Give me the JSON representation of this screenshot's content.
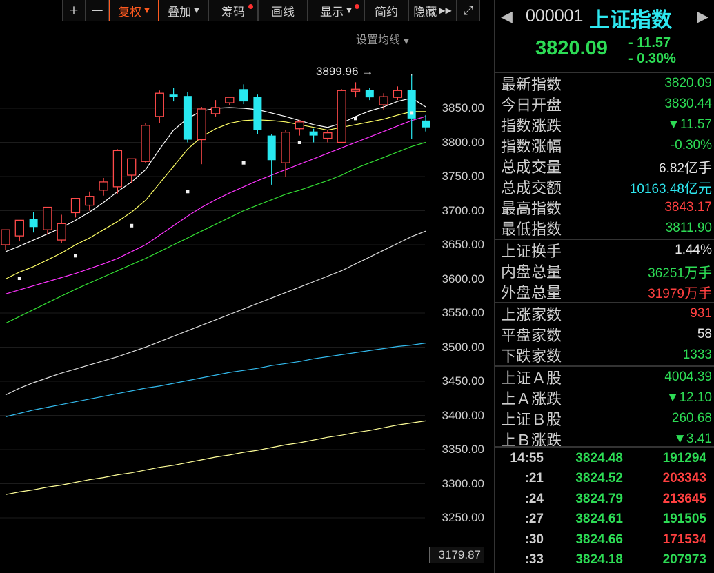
{
  "toolbar": {
    "buttons": [
      "+",
      "—",
      "复权",
      "叠加",
      "筹码",
      "画线",
      "显示",
      "简约",
      "隐藏"
    ],
    "more_icon": "double-chevron-right-icon",
    "expand_icon": "fullscreen-icon",
    "active_color": "#ff5a1f"
  },
  "ma_setting": "设置均线",
  "price_axis": [
    "3850.00",
    "3800.00",
    "3750.00",
    "3700.00",
    "3650.00",
    "3600.00",
    "3550.00",
    "3500.00",
    "3450.00",
    "3400.00",
    "3350.00",
    "3300.00",
    "3250.00"
  ],
  "low_label": "3179.87",
  "high_annotation": "3899.96",
  "chart_data": {
    "type": "candlestick",
    "ylim": [
      3179.87,
      3950
    ],
    "up_color": "#ff4a4a",
    "down_color": "#28e8f0",
    "candles": [
      [
        3650,
        3672,
        3642,
        3665
      ],
      [
        3663,
        3686,
        3655,
        3678
      ],
      [
        3688,
        3676,
        3668,
        3698
      ],
      [
        3672,
        3705,
        3665,
        3695
      ],
      [
        3657,
        3681,
        3653,
        3694
      ],
      [
        3697,
        3718,
        3690,
        3712
      ],
      [
        3708,
        3721,
        3700,
        3728
      ],
      [
        3730,
        3742,
        3722,
        3748
      ],
      [
        3735,
        3788,
        3725,
        3790
      ],
      [
        3752,
        3776,
        3740,
        3768
      ],
      [
        3772,
        3825,
        3770,
        3828
      ],
      [
        3838,
        3872,
        3828,
        3876
      ],
      [
        3870,
        3867,
        3860,
        3880
      ],
      [
        3868,
        3804,
        3800,
        3874
      ],
      [
        3804,
        3849,
        3768,
        3852
      ],
      [
        3842,
        3851,
        3838,
        3862
      ],
      [
        3858,
        3866,
        3855,
        3866
      ],
      [
        3878,
        3860,
        3856,
        3885
      ],
      [
        3867,
        3818,
        3812,
        3870
      ],
      [
        3810,
        3774,
        3738,
        3812
      ],
      [
        3770,
        3815,
        3750,
        3818
      ],
      [
        3820,
        3830,
        3810,
        3833
      ],
      [
        3816,
        3810,
        3800,
        3820
      ],
      [
        3806,
        3814,
        3800,
        3818
      ],
      [
        3800,
        3876,
        3800,
        3878
      ],
      [
        3875,
        3878,
        3866,
        3888
      ],
      [
        3877,
        3866,
        3862,
        3880
      ],
      [
        3855,
        3867,
        3848,
        3872
      ],
      [
        3866,
        3876,
        3862,
        3882
      ],
      [
        3877,
        3835,
        3805,
        3900
      ],
      [
        3832,
        3822,
        3816,
        3840
      ]
    ],
    "ma_lines": [
      {
        "color": "#ffffff",
        "values": [
          3640,
          3648,
          3657,
          3666,
          3675,
          3686,
          3698,
          3712,
          3728,
          3742,
          3760,
          3790,
          3818,
          3835,
          3846,
          3850,
          3851,
          3850,
          3848,
          3843,
          3838,
          3832,
          3826,
          3822,
          3828,
          3838,
          3846,
          3852,
          3860,
          3865,
          3852
        ]
      },
      {
        "color": "#ffff66",
        "values": [
          3600,
          3610,
          3618,
          3628,
          3638,
          3650,
          3660,
          3672,
          3684,
          3698,
          3715,
          3740,
          3765,
          3790,
          3808,
          3820,
          3828,
          3832,
          3833,
          3832,
          3830,
          3826,
          3822,
          3818,
          3822,
          3826,
          3830,
          3834,
          3840,
          3845,
          3845
        ]
      },
      {
        "color": "#ff33ff",
        "values": [
          3578,
          3584,
          3590,
          3596,
          3602,
          3608,
          3615,
          3622,
          3630,
          3640,
          3650,
          3664,
          3678,
          3692,
          3705,
          3716,
          3726,
          3735,
          3744,
          3752,
          3760,
          3768,
          3776,
          3784,
          3792,
          3800,
          3808,
          3816,
          3824,
          3832,
          3838
        ]
      },
      {
        "color": "#33dd33",
        "values": [
          3535,
          3545,
          3555,
          3565,
          3575,
          3585,
          3594,
          3603,
          3612,
          3621,
          3630,
          3640,
          3650,
          3660,
          3670,
          3680,
          3690,
          3700,
          3708,
          3716,
          3724,
          3730,
          3737,
          3744,
          3752,
          3762,
          3770,
          3778,
          3786,
          3794,
          3800
        ]
      },
      {
        "color": "#dddddd",
        "values": [
          3430,
          3440,
          3448,
          3455,
          3462,
          3468,
          3474,
          3480,
          3486,
          3493,
          3500,
          3508,
          3516,
          3524,
          3532,
          3540,
          3548,
          3556,
          3564,
          3572,
          3580,
          3588,
          3596,
          3604,
          3612,
          3622,
          3632,
          3642,
          3652,
          3662,
          3670
        ]
      },
      {
        "color": "#33bbee",
        "values": [
          3398,
          3403,
          3408,
          3412,
          3416,
          3420,
          3424,
          3428,
          3432,
          3436,
          3440,
          3443,
          3447,
          3451,
          3455,
          3459,
          3463,
          3466,
          3469,
          3473,
          3476,
          3479,
          3483,
          3486,
          3489,
          3492,
          3495,
          3498,
          3501,
          3503,
          3506
        ]
      },
      {
        "color": "#ffff99",
        "values": [
          3284,
          3288,
          3291,
          3295,
          3298,
          3302,
          3306,
          3309,
          3313,
          3316,
          3320,
          3324,
          3327,
          3331,
          3335,
          3339,
          3342,
          3346,
          3349,
          3353,
          3357,
          3360,
          3364,
          3368,
          3371,
          3375,
          3378,
          3382,
          3386,
          3389,
          3392
        ]
      }
    ],
    "markers": [
      {
        "i": 1,
        "y": 3601
      },
      {
        "i": 5,
        "y": 3634
      },
      {
        "i": 9,
        "y": 3678
      },
      {
        "i": 13,
        "y": 3728
      },
      {
        "i": 17,
        "y": 3770
      },
      {
        "i": 21,
        "y": 3800
      },
      {
        "i": 25,
        "y": 3835
      },
      {
        "i": 29,
        "y": 3843
      }
    ]
  },
  "quote": {
    "code": "000001",
    "name": "上证指数",
    "price": "3820.09",
    "change": "- 11.57",
    "change_pct": "- 0.30%",
    "nav_prev_icon": "triangle-left-icon",
    "nav_next_icon": "triangle-right-icon"
  },
  "stats": {
    "latest": {
      "label": "最新指数",
      "value": "3820.09"
    },
    "open": {
      "label": "今日开盘",
      "value": "3830.44"
    },
    "change": {
      "label": "指数涨跌",
      "value": "▼11.57"
    },
    "change_pct": {
      "label": "指数涨幅",
      "value": "-0.30%"
    },
    "volume": {
      "label": "总成交量",
      "value": "6.82",
      "unit": "亿手"
    },
    "amount": {
      "label": "总成交额",
      "value": "10163.48",
      "unit": "亿元"
    },
    "high": {
      "label": "最高指数",
      "value": "3843.17"
    },
    "low": {
      "label": "最低指数",
      "value": "3811.90"
    },
    "turnover": {
      "label": "上证换手",
      "value": "1.44%"
    },
    "inner": {
      "label": "内盘总量",
      "value": "36251",
      "unit": "万手"
    },
    "outer": {
      "label": "外盘总量",
      "value": "31979",
      "unit": "万手"
    },
    "up_count": {
      "label": "上涨家数",
      "value": "931"
    },
    "flat_count": {
      "label": "平盘家数",
      "value": "58"
    },
    "down_count": {
      "label": "下跌家数",
      "value": "1333"
    },
    "a_share": {
      "label": "上证Ａ股",
      "value": "4004.39"
    },
    "a_change": {
      "label": "上Ａ涨跌",
      "value": "▼12.10"
    },
    "b_share": {
      "label": "上证Ｂ股",
      "value": "260.68"
    },
    "b_change": {
      "label": "上Ｂ涨跌",
      "value": "▼3.41"
    }
  },
  "ticks": [
    {
      "time": "14:55",
      "price": "3824.48",
      "vol": "191294",
      "vol_color": "green"
    },
    {
      "time": ":21",
      "price": "3824.52",
      "vol": "203343",
      "vol_color": "red"
    },
    {
      "time": ":24",
      "price": "3824.79",
      "vol": "213645",
      "vol_color": "red"
    },
    {
      "time": ":27",
      "price": "3824.61",
      "vol": "191505",
      "vol_color": "green"
    },
    {
      "time": ":30",
      "price": "3824.66",
      "vol": "171534",
      "vol_color": "red"
    },
    {
      "time": ":33",
      "price": "3824.18",
      "vol": "207973",
      "vol_color": "green"
    }
  ]
}
